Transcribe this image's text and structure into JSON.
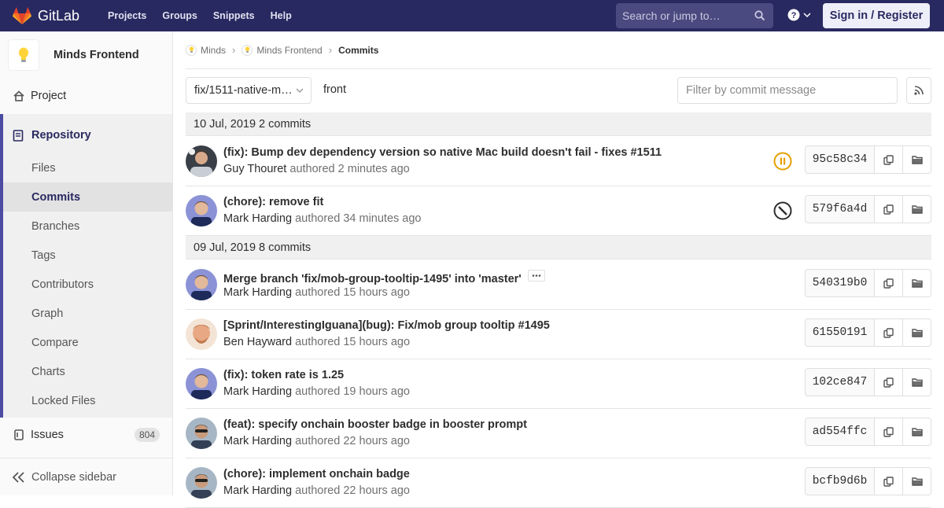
{
  "navbar": {
    "brand": "GitLab",
    "links": [
      "Projects",
      "Groups",
      "Snippets",
      "Help"
    ],
    "search_placeholder": "Search or jump to…",
    "sign_in": "Sign in / Register",
    "bg_color": "#292961"
  },
  "sidebar": {
    "project_name": "Minds Frontend",
    "project_item": "Project",
    "repository": "Repository",
    "repo_items": [
      "Files",
      "Commits",
      "Branches",
      "Tags",
      "Contributors",
      "Graph",
      "Compare",
      "Charts",
      "Locked Files"
    ],
    "active_item": "Commits",
    "issues": "Issues",
    "issues_count": "804",
    "collapse": "Collapse sidebar"
  },
  "breadcrumbs": [
    "Minds",
    "Minds Frontend",
    "Commits"
  ],
  "toolbar": {
    "branch": "fix/1511-native-m…",
    "path": "front",
    "filter_placeholder": "Filter by commit message"
  },
  "days": [
    {
      "header": "10 Jul, 2019 2 commits",
      "commits": [
        {
          "title": "(fix): Bump dev dependency version so native Mac build doesn't fail - fixes #1511",
          "author": "Guy Thouret",
          "authored": "authored",
          "time": "2 minutes ago",
          "sha": "95c58c34",
          "status": "pending",
          "avatar": "guy"
        },
        {
          "title": "(chore): remove fit",
          "author": "Mark Harding",
          "authored": "authored",
          "time": "34 minutes ago",
          "sha": "579f6a4d",
          "status": "skipped",
          "avatar": "mark"
        }
      ]
    },
    {
      "header": "09 Jul, 2019 8 commits",
      "commits": [
        {
          "title": "Merge branch 'fix/mob-group-tooltip-1495' into 'master'",
          "author": "Mark Harding",
          "authored": "authored",
          "time": "15 hours ago",
          "sha": "540319b0",
          "status": "none",
          "avatar": "mark",
          "ellipsis": true
        },
        {
          "title": "[Sprint/InterestingIguana](bug): Fix/mob group tooltip #1495",
          "author": "Ben Hayward",
          "authored": "authored",
          "time": "15 hours ago",
          "sha": "61550191",
          "status": "none",
          "avatar": "ben"
        },
        {
          "title": "(fix): token rate is 1.25",
          "author": "Mark Harding",
          "authored": "authored",
          "time": "19 hours ago",
          "sha": "102ce847",
          "status": "none",
          "avatar": "mark"
        },
        {
          "title": "(feat): specify onchain booster badge in booster prompt",
          "author": "Mark Harding",
          "authored": "authored",
          "time": "22 hours ago",
          "sha": "ad554ffc",
          "status": "none",
          "avatar": "mark2"
        },
        {
          "title": "(chore): implement onchain badge",
          "author": "Mark Harding",
          "authored": "authored",
          "time": "22 hours ago",
          "sha": "bcfb9d6b",
          "status": "none",
          "avatar": "mark2"
        }
      ]
    }
  ],
  "colors": {
    "pending": "#e5a000",
    "accent": "#292961",
    "sidebar_active": "#4b4ba3"
  }
}
